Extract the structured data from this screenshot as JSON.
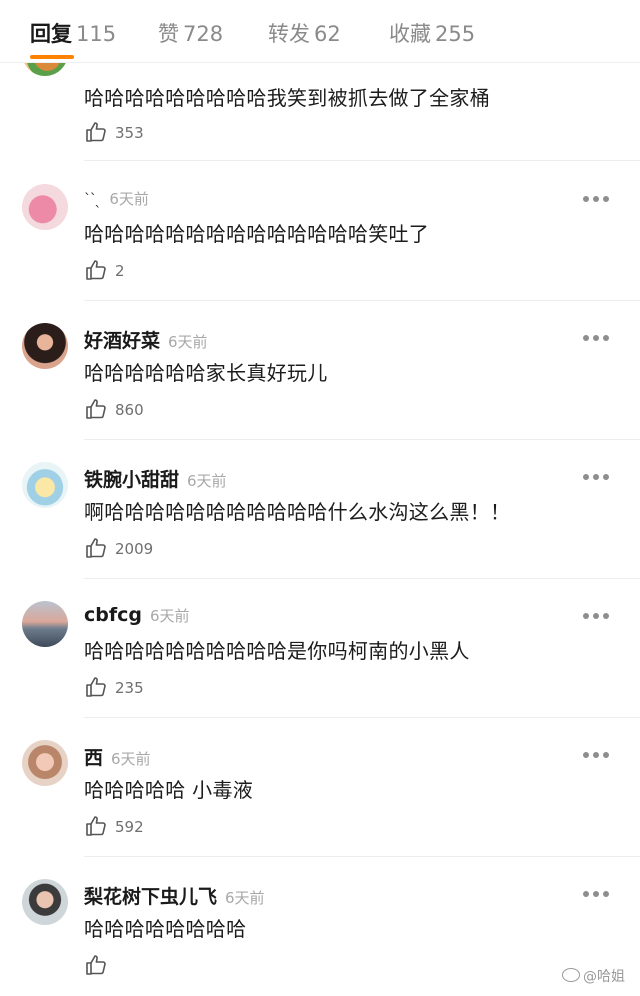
{
  "tabs": [
    {
      "label": "回复",
      "count": "115",
      "active": true
    },
    {
      "label": "赞",
      "count": "728"
    },
    {
      "label": "转发",
      "count": "62"
    },
    {
      "label": "收藏",
      "count": "255"
    }
  ],
  "comments": [
    {
      "name": "",
      "time": "",
      "text": "哈哈哈哈哈哈哈哈哈我笑到被抓去做了全家桶",
      "likes": "353"
    },
    {
      "name": "",
      "time": "6天前",
      "text": "哈哈哈哈哈哈哈哈哈哈哈哈哈哈笑吐了",
      "likes": "2"
    },
    {
      "name": "好酒好菜",
      "time": "6天前",
      "text": "哈哈哈哈哈哈家长真好玩儿",
      "likes": "860"
    },
    {
      "name": "铁腕小甜甜",
      "time": "6天前",
      "text": "啊哈哈哈哈哈哈哈哈哈哈哈什么水沟这么黑！！",
      "likes": "2009"
    },
    {
      "name": "cbfcg",
      "time": "6天前",
      "text": "哈哈哈哈哈哈哈哈哈哈是你吗柯南的小黑人",
      "likes": "235"
    },
    {
      "name": "西",
      "time": "6天前",
      "text": "哈哈哈哈哈 小毒液",
      "likes": "592"
    },
    {
      "name": "梨花树下虫儿飞",
      "time": "6天前",
      "text": "哈哈哈哈哈哈哈哈",
      "likes": ""
    }
  ],
  "watermark": "@哈姐",
  "colors": {
    "accent": "#ff8200",
    "meta": "#a8a8a8",
    "divider": "#ededed"
  }
}
